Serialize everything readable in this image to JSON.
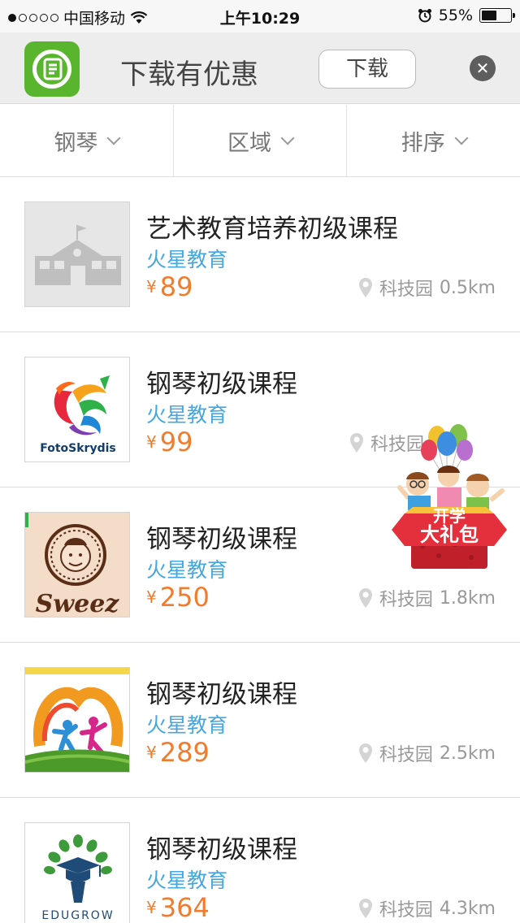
{
  "status_bar": {
    "carrier": "中国移动",
    "time": "上午10:29",
    "battery": "55%",
    "battery_level": 0.55
  },
  "banner": {
    "title": "下载有优惠",
    "download_label": "下载",
    "close_glyph": "✕"
  },
  "filters": [
    {
      "label": "钢琴"
    },
    {
      "label": "区域"
    },
    {
      "label": "排序"
    }
  ],
  "currency": "¥",
  "courses": [
    {
      "title": "艺术教育培养初级课程",
      "org": "火星教育",
      "price": "89",
      "location": "科技园",
      "distance": "0.5km",
      "thumb_icon": "school-building-icon"
    },
    {
      "title": "钢琴初级课程",
      "org": "火星教育",
      "price": "99",
      "location": "科技园",
      "distance": "",
      "thumb_icon": "fotoskrydis-logo",
      "logo_text": "FotoSkrydis"
    },
    {
      "title": "钢琴初级课程",
      "org": "火星教育",
      "price": "250",
      "location": "科技园",
      "distance": "1.8km",
      "thumb_icon": "sweez-logo",
      "logo_text": "Sweez"
    },
    {
      "title": "钢琴初级课程",
      "org": "火星教育",
      "price": "289",
      "location": "科技园",
      "distance": "2.5km",
      "thumb_icon": "kids-rainbow-logo"
    },
    {
      "title": "钢琴初级课程",
      "org": "火星教育",
      "price": "364",
      "location": "科技园",
      "distance": "4.3km",
      "thumb_icon": "edugrow-logo",
      "logo_text": "EDUGROW"
    }
  ],
  "promo": {
    "line1": "开学",
    "line2": "大礼包"
  },
  "colors": {
    "accent_blue": "#45a7e0",
    "price_orange": "#f17c2d",
    "app_green": "#5ab52e"
  }
}
